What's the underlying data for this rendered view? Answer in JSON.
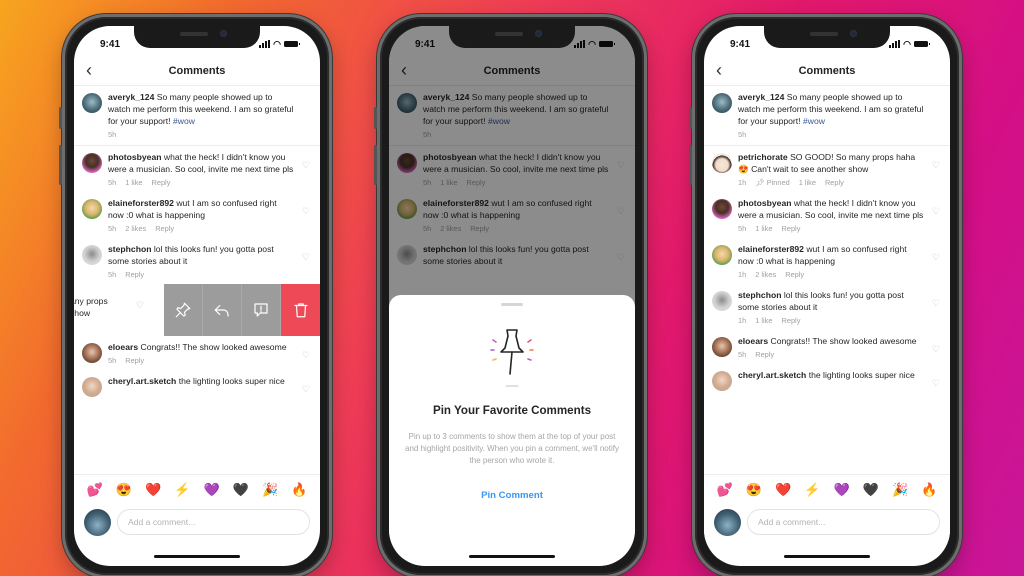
{
  "status_bar": {
    "time": "9:41"
  },
  "header": {
    "back_icon": "chevron-left-icon",
    "title": "Comments"
  },
  "caption": {
    "username": "averyk_124",
    "text": "So many people showed up to watch me perform this weekend. I am so grateful for your support!",
    "hashtag": "#wow",
    "time": "5h"
  },
  "phone1": {
    "comments": [
      {
        "username": "photosbyean",
        "text": "what the heck! I didn't know you were a musician. So cool, invite me next time pls",
        "time": "5h",
        "likes": "1 like",
        "reply": "Reply"
      },
      {
        "username": "elaineforster892",
        "text": "wut I am so confused right now :0 what is happening",
        "time": "5h",
        "likes": "2 likes",
        "reply": "Reply"
      },
      {
        "username": "stephchon",
        "text": "lol this looks fun! you gotta post some stories about it",
        "time": "5h",
        "reply": "Reply"
      }
    ],
    "swiped_row": {
      "partial_text_line1": "any props",
      "partial_text_line2": "show",
      "actions": [
        {
          "name": "pin",
          "icon": "pin-icon"
        },
        {
          "name": "reply",
          "icon": "reply-icon"
        },
        {
          "name": "report",
          "icon": "report-icon"
        },
        {
          "name": "delete",
          "icon": "trash-icon"
        }
      ]
    },
    "comments_after": [
      {
        "username": "eloears",
        "text": "Congrats!! The show looked awesome",
        "time": "5h",
        "reply": "Reply"
      },
      {
        "username": "cheryl.art.sketch",
        "text": "the lighting looks super nice"
      }
    ]
  },
  "phone2": {
    "sheet": {
      "title": "Pin Your Favorite Comments",
      "description": "Pin up to 3 comments to show them at the top of your post and highlight positivity. When you pin a comment, we'll notify the person who wrote it.",
      "cta": "Pin Comment"
    }
  },
  "phone3": {
    "comments": [
      {
        "username": "petrichorate",
        "text": "SO GOOD! So many props haha 😍 Can't wait to see another show",
        "time": "1h",
        "pinned": "Pinned",
        "likes": "1 like",
        "reply": "Reply"
      },
      {
        "username": "photosbyean",
        "text": "what the heck! I didn't know you were a musician. So cool, invite me next time pls",
        "time": "5h",
        "likes": "1 like",
        "reply": "Reply"
      },
      {
        "username": "elaineforster892",
        "text": "wut I am so confused right now :0 what is happening",
        "time": "1h",
        "likes": "2 likes",
        "reply": "Reply"
      },
      {
        "username": "stephchon",
        "text": "lol this looks fun! you gotta post some stories about it",
        "time": "1h",
        "likes": "1 like",
        "reply": "Reply"
      },
      {
        "username": "eloears",
        "text": "Congrats!! The show looked awesome",
        "time": "5h",
        "reply": "Reply"
      },
      {
        "username": "cheryl.art.sketch",
        "text": "the lighting looks super nice"
      }
    ]
  },
  "emoji_bar": [
    "💕",
    "😍",
    "❤️",
    "⚡",
    "💜",
    "🖤",
    "🎉",
    "🔥"
  ],
  "compose": {
    "placeholder": "Add a comment..."
  },
  "colors": {
    "delete_action": "#ed4956",
    "swipe_action": "#9c9c9c",
    "link_blue": "#3897f0",
    "hashtag": "#385898"
  }
}
